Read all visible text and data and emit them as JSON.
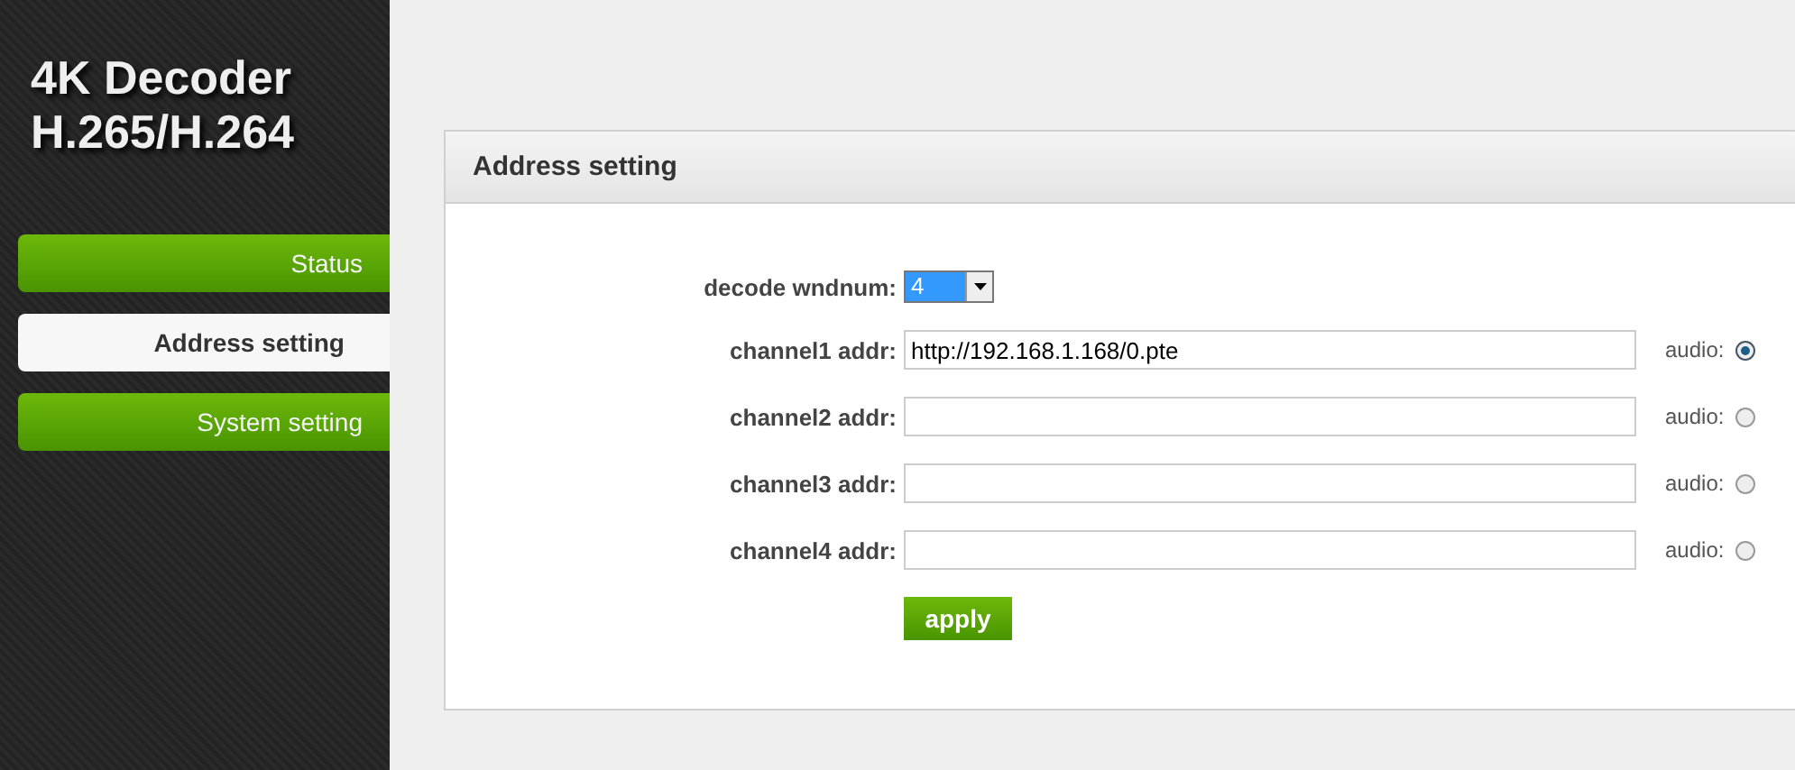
{
  "logo": {
    "lines": [
      "4K Decoder",
      "H.265/H.264"
    ]
  },
  "sidebar": {
    "items": [
      {
        "label": "Status",
        "selected": false
      },
      {
        "label": "Address setting",
        "selected": true
      },
      {
        "label": "System setting",
        "selected": false
      }
    ]
  },
  "panel": {
    "title": "Address setting",
    "wndnum": {
      "label": "decode wndnum:",
      "value": "4"
    },
    "channels": [
      {
        "label": "channel1 addr:",
        "value": "http://192.168.1.168/0.pte",
        "audio_label": "audio:",
        "audio_selected": true
      },
      {
        "label": "channel2 addr:",
        "audio_label": "audio:",
        "audio_selected": false
      },
      {
        "label": "channel3 addr:",
        "audio_label": "audio:",
        "audio_selected": false
      },
      {
        "label": "channel4 addr:",
        "audio_label": "audio:",
        "audio_selected": false
      }
    ],
    "apply": "apply"
  }
}
